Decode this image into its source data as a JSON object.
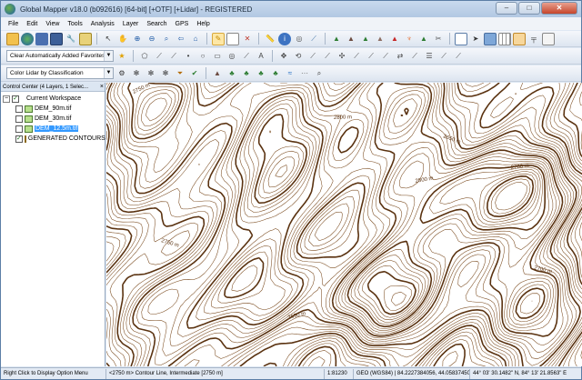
{
  "window": {
    "title": "Global Mapper v18.0 (b092616) [64-bit] [+OTF] [+Lidar] - REGISTERED",
    "minimize": "–",
    "maximize": "□",
    "close": "✕"
  },
  "menu": [
    "File",
    "Edit",
    "View",
    "Tools",
    "Analysis",
    "Layer",
    "Search",
    "GPS",
    "Help"
  ],
  "toolbars": {
    "favorites_combo": "Clear Automatically Added Favorites",
    "lidar_combo": "Color Lidar by Classification"
  },
  "control_center": {
    "header": "Control Center (4 Layers, 1 Selec...",
    "close": "×",
    "workspace": "Current Workspace",
    "layers": [
      {
        "name": "DEM_90m.tif",
        "checked": false,
        "selected": false
      },
      {
        "name": "DEM_30m.tif",
        "checked": false,
        "selected": false
      },
      {
        "name": "DEM_12.5m.tif",
        "checked": false,
        "selected": true
      },
      {
        "name": "GENERATED CONTOURS",
        "checked": true,
        "selected": false
      }
    ]
  },
  "map": {
    "contour_labels": [
      "2750 m",
      "2800 m",
      "2650 m",
      "2700 m",
      "2750 m",
      "2800 m",
      "2700 m",
      "2650 m"
    ]
  },
  "status": {
    "hint": "Right Click to Display Option Menu",
    "feature": "<2750 m> Contour Line, Intermediate [2750 m]",
    "scale": "1:81230",
    "projection": "GEO (WGS84) | 84.2227384056, 44.0583745070 |",
    "coords": "44° 03' 30.1482\" N, 84° 13' 21.8563\" E"
  },
  "colors": {
    "contour": "#7a4a1e",
    "index_contour": "#5a3210",
    "selection": "#3399ff"
  }
}
